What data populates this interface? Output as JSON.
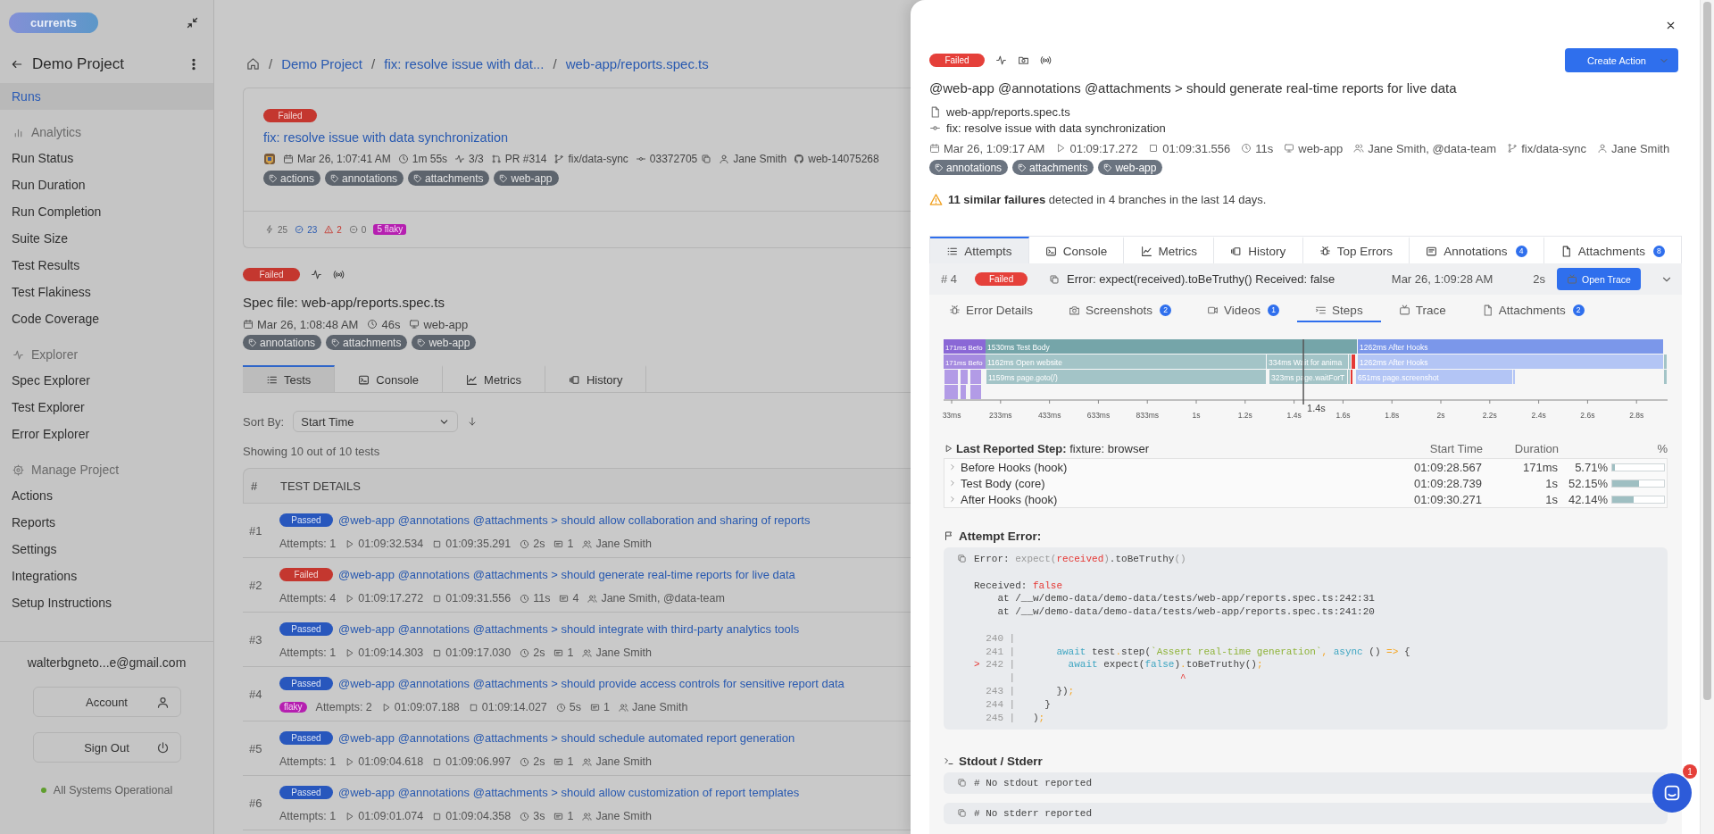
{
  "sidebar": {
    "logo": "currents",
    "project": "Demo Project",
    "nav": [
      {
        "label": "Runs",
        "selected": true
      }
    ],
    "sections": [
      {
        "kind": "analytics",
        "label": "Analytics",
        "items": [
          {
            "label": "Run Status",
            "selected": false
          },
          {
            "label": "Run Duration",
            "selected": false
          },
          {
            "label": "Run Completion",
            "selected": false
          },
          {
            "label": "Suite Size",
            "selected": false
          },
          {
            "label": "Test Results",
            "selected": false
          },
          {
            "label": "Test Flakiness",
            "selected": false
          },
          {
            "label": "Code Coverage",
            "selected": false
          }
        ]
      },
      {
        "kind": "explorer",
        "label": "Explorer",
        "items": [
          {
            "label": "Spec Explorer",
            "selected": false
          },
          {
            "label": "Test Explorer",
            "selected": false
          },
          {
            "label": "Error Explorer",
            "selected": false
          }
        ]
      },
      {
        "kind": "manage",
        "label": "Manage Project",
        "items": [
          {
            "label": "Actions",
            "selected": false
          },
          {
            "label": "Reports",
            "selected": false
          },
          {
            "label": "Settings",
            "selected": false
          },
          {
            "label": "Integrations",
            "selected": false
          },
          {
            "label": "Setup Instructions",
            "selected": false
          }
        ]
      }
    ],
    "email": "walterbgneto...e@gmail.com",
    "buttons": [
      {
        "kind": "account",
        "label": "Account"
      },
      {
        "kind": "sign-out",
        "label": "Sign Out"
      }
    ],
    "status": "All Systems Operational"
  },
  "main": {
    "breadcrumb": [
      {
        "kind": "home"
      },
      {
        "kind": "separator",
        "text": "/"
      },
      {
        "kind": "link",
        "text": "Demo Project"
      },
      {
        "kind": "separator",
        "text": "/"
      },
      {
        "kind": "link",
        "text": "fix: resolve issue with dat..."
      },
      {
        "kind": "separator",
        "text": "/"
      },
      {
        "kind": "link",
        "text": "web-app/reports.spec.ts"
      }
    ],
    "run": {
      "badge": {
        "label": "Failed",
        "kind": "failed"
      },
      "title": "fix: resolve issue with data synchronization",
      "meta": [
        {
          "kind": "date",
          "text": "Mar 26, 1:07:41 AM"
        },
        {
          "kind": "duration",
          "text": "1m 55s"
        },
        {
          "kind": "progress",
          "text": "3/3"
        },
        {
          "kind": "pull-request",
          "text": "PR #314"
        },
        {
          "kind": "branch",
          "text": "fix/data-sync"
        },
        {
          "kind": "commit",
          "text": "03372705"
        },
        {
          "kind": "user",
          "text": "Jane Smith"
        },
        {
          "kind": "github",
          "text": "web-14075268"
        }
      ],
      "tags": [
        "actions",
        "annotations",
        "attachments",
        "web-app"
      ],
      "stats": [
        {
          "kind": "total",
          "text": "25"
        },
        {
          "kind": "passed",
          "text": "23"
        },
        {
          "kind": "failed",
          "text": "2"
        },
        {
          "kind": "skipped",
          "text": "0"
        },
        {
          "kind": "flaky",
          "text": "5 flaky"
        }
      ]
    },
    "spec": {
      "badge": {
        "label": "Failed",
        "kind": "failed"
      },
      "title": "Spec file: web-app/reports.spec.ts",
      "meta": [
        {
          "kind": "date",
          "text": "Mar 26, 1:08:48 AM"
        },
        {
          "kind": "duration",
          "text": "46s"
        },
        {
          "kind": "machine",
          "text": "web-app"
        }
      ],
      "tags": [
        "annotations",
        "attachments",
        "web-app"
      ]
    },
    "tabs": [
      {
        "kind": "tests",
        "label": "Tests",
        "selected": true
      },
      {
        "kind": "console",
        "label": "Console",
        "selected": false
      },
      {
        "kind": "metrics",
        "label": "Metrics",
        "selected": false
      },
      {
        "kind": "history",
        "label": "History",
        "selected": false
      }
    ],
    "sort": {
      "label": "Sort By:",
      "value": "Start Time"
    },
    "count": "Showing 10 out of 10 tests",
    "table": {
      "columns": [
        "#",
        "TEST DETAILS"
      ],
      "rows": [
        {
          "index": "#1",
          "badge": {
            "label": "Passed",
            "kind": "passed"
          },
          "title": "@web-app @annotations @attachments > should allow collaboration and sharing of reports",
          "meta": [
            {
              "kind": "attempts",
              "text": "Attempts: 1"
            },
            {
              "kind": "start",
              "text": "01:09:32.534"
            },
            {
              "kind": "end",
              "text": "01:09:35.291"
            },
            {
              "kind": "duration",
              "text": "2s"
            },
            {
              "kind": "comments",
              "text": "1"
            },
            {
              "kind": "owners",
              "text": "Jane Smith"
            }
          ]
        },
        {
          "index": "#2",
          "badge": {
            "label": "Failed",
            "kind": "failed"
          },
          "title": "@web-app @annotations @attachments > should generate real-time reports for live data",
          "meta": [
            {
              "kind": "attempts",
              "text": "Attempts: 4"
            },
            {
              "kind": "start",
              "text": "01:09:17.272"
            },
            {
              "kind": "end",
              "text": "01:09:31.556"
            },
            {
              "kind": "duration",
              "text": "11s"
            },
            {
              "kind": "comments",
              "text": "4"
            },
            {
              "kind": "owners",
              "text": "Jane Smith, @data-team"
            }
          ]
        },
        {
          "index": "#3",
          "badge": {
            "label": "Passed",
            "kind": "passed"
          },
          "title": "@web-app @annotations @attachments > should integrate with third-party analytics tools",
          "meta": [
            {
              "kind": "attempts",
              "text": "Attempts: 1"
            },
            {
              "kind": "start",
              "text": "01:09:14.303"
            },
            {
              "kind": "end",
              "text": "01:09:17.030"
            },
            {
              "kind": "duration",
              "text": "2s"
            },
            {
              "kind": "comments",
              "text": "1"
            },
            {
              "kind": "owners",
              "text": "Jane Smith"
            }
          ]
        },
        {
          "index": "#4",
          "badge": {
            "label": "Passed",
            "kind": "passed"
          },
          "title": "@web-app @annotations @attachments > should provide access controls for sensitive report data",
          "flag": "flaky",
          "meta": [
            {
              "kind": "attempts",
              "text": "Attempts: 2"
            },
            {
              "kind": "start",
              "text": "01:09:07.188"
            },
            {
              "kind": "end",
              "text": "01:09:14.027"
            },
            {
              "kind": "duration",
              "text": "5s"
            },
            {
              "kind": "comments",
              "text": "1"
            },
            {
              "kind": "owners",
              "text": "Jane Smith"
            }
          ]
        },
        {
          "index": "#5",
          "badge": {
            "label": "Passed",
            "kind": "passed"
          },
          "title": "@web-app @annotations @attachments > should schedule automated report generation",
          "meta": [
            {
              "kind": "attempts",
              "text": "Attempts: 1"
            },
            {
              "kind": "start",
              "text": "01:09:04.618"
            },
            {
              "kind": "end",
              "text": "01:09:06.997"
            },
            {
              "kind": "duration",
              "text": "2s"
            },
            {
              "kind": "comments",
              "text": "1"
            },
            {
              "kind": "owners",
              "text": "Jane Smith"
            }
          ]
        },
        {
          "index": "#6",
          "badge": {
            "label": "Passed",
            "kind": "passed"
          },
          "title": "@web-app @annotations @attachments > should allow customization of report templates",
          "meta": [
            {
              "kind": "attempts",
              "text": "Attempts: 1"
            },
            {
              "kind": "start",
              "text": "01:09:01.074"
            },
            {
              "kind": "end",
              "text": "01:09:04.358"
            },
            {
              "kind": "duration",
              "text": "3s"
            },
            {
              "kind": "comments",
              "text": "1"
            },
            {
              "kind": "owners",
              "text": "Jane Smith"
            }
          ]
        }
      ]
    }
  },
  "drawer": {
    "badge": {
      "label": "Failed",
      "kind": "failed"
    },
    "action": "Create Action",
    "title": "@web-app @annotations @attachments > should generate real-time reports for live data",
    "file": "web-app/reports.spec.ts",
    "commit": "fix: resolve issue with data synchronization",
    "meta": [
      {
        "kind": "date",
        "text": "Mar 26, 1:09:17 AM"
      },
      {
        "kind": "start",
        "text": "01:09:17.272"
      },
      {
        "kind": "end",
        "text": "01:09:31.556"
      },
      {
        "kind": "duration",
        "text": "11s"
      },
      {
        "kind": "machine",
        "text": "web-app"
      },
      {
        "kind": "owners",
        "text": "Jane Smith, @data-team"
      },
      {
        "kind": "branch",
        "text": "fix/data-sync"
      },
      {
        "kind": "user",
        "text": "Jane Smith"
      }
    ],
    "tags": [
      "annotations",
      "attachments",
      "web-app"
    ],
    "warning": "**11 similar failures** detected in 4 branches in the last 14 days.",
    "tabs": [
      {
        "kind": "attempts",
        "label": "Attempts",
        "selected": true
      },
      {
        "kind": "console",
        "label": "Console",
        "selected": false
      },
      {
        "kind": "metrics",
        "label": "Metrics",
        "selected": false
      },
      {
        "kind": "history",
        "label": "History",
        "selected": false
      },
      {
        "kind": "errors",
        "label": "Top Errors",
        "selected": false
      },
      {
        "kind": "annotations",
        "label": "Annotations",
        "count": "4",
        "selected": false
      },
      {
        "kind": "attachments",
        "label": "Attachments",
        "count": "8",
        "selected": false
      }
    ],
    "attempt": {
      "number": "# 4",
      "badge": {
        "label": "Failed",
        "kind": "failed"
      },
      "error": "Error: expect(received).toBeTruthy() Received: false",
      "time": "Mar 26, 1:09:28 AM",
      "duration": "2s",
      "button": "Open Trace",
      "expanded": true
    },
    "subtabs": [
      {
        "kind": "errors",
        "label": "Error Details",
        "selected": false
      },
      {
        "kind": "screenshots",
        "label": "Screenshots",
        "count": "2",
        "selected": false
      },
      {
        "kind": "videos",
        "label": "Videos",
        "count": "1",
        "selected": false
      },
      {
        "kind": "steps",
        "label": "Steps",
        "selected": true
      },
      {
        "kind": "trace",
        "label": "Trace",
        "selected": false
      },
      {
        "kind": "attachments",
        "label": "Attachments",
        "count": "2",
        "selected": false
      }
    ],
    "timeline": {
      "ticks": [
        "33ms",
        "233ms",
        "433ms",
        "633ms",
        "833ms",
        "1s",
        "1.2s",
        "1.4s",
        "1.6s",
        "1.8s",
        "2s",
        "2.2s",
        "2.4s",
        "2.6s",
        "2.8s"
      ],
      "cursor": "1.4s",
      "lanes": [
        {
          "bars": [
            {
              "label": "171ms Befo",
              "color": "#8a67d6"
            },
            {
              "label": "1530ms Test Body",
              "color": "#75a5a9"
            },
            {
              "label": "1262ms After Hooks",
              "color": "#7b97ea"
            }
          ]
        },
        {
          "bars": [
            {
              "label": "171ms Befo",
              "color": "#a58ae0"
            },
            {
              "label": "1162ms Open website",
              "color": "#a3c4c7"
            },
            {
              "label": "334ms Wait for anima",
              "color": "#a3c4c7"
            },
            {
              "color": "#a3c4c7"
            },
            {
              "color": "#e53935"
            },
            {
              "label": "1262ms After Hooks",
              "color": "#b3c5f5"
            },
            {
              "color": "#a3c4c7"
            }
          ]
        },
        {
          "bars": [
            {
              "color": "#b29be6"
            },
            {
              "color": "#b29be6"
            },
            {
              "color": "#b29be6"
            },
            {
              "label": "1159ms page.goto(/)",
              "color": "#a3c4c7"
            },
            {
              "label": "323ms page.waitForT",
              "color": "#a3c4c7"
            },
            {
              "color": "#a3c4c7"
            },
            {
              "color": "#e53935"
            },
            {
              "label": "651ms page.screenshot",
              "color": "#b3c5f5"
            },
            {
              "color": "#b3c5f5"
            },
            {
              "color": "#a3c4c7"
            }
          ]
        },
        {
          "bars": [
            {
              "color": "#b29be6"
            },
            {
              "color": "#b29be6"
            },
            {
              "color": "#b29be6"
            }
          ]
        }
      ]
    },
    "last_step": "**Last Reported Step:** fixture: browser",
    "steps": {
      "columns": [
        "Start Time",
        "Duration",
        "%"
      ],
      "rows": [
        {
          "name": "Before Hooks (hook)",
          "start": "01:09:28.567",
          "duration": "171ms",
          "percent": "5.71%",
          "level": 0.0571
        },
        {
          "name": "Test Body (core)",
          "start": "01:09:28.739",
          "duration": "1s",
          "percent": "52.15%",
          "level": 0.5215
        },
        {
          "name": "After Hooks (hook)",
          "start": "01:09:30.271",
          "duration": "1s",
          "percent": "42.14%",
          "level": 0.4214
        }
      ]
    },
    "attempt_error": {
      "title": "Attempt Error:",
      "lines": [
        {
          "kind": "text",
          "tokens": [
            {
              "text": "Error: ",
              "kind": "plain"
            },
            {
              "text": "expect(",
              "kind": "dim"
            },
            {
              "text": "received",
              "kind": "red"
            },
            {
              "text": ")",
              "kind": "dim"
            },
            {
              "text": ".toBeTruthy",
              "kind": "plain"
            },
            {
              "text": "()",
              "kind": "dim"
            }
          ]
        },
        {
          "kind": "gap"
        },
        {
          "kind": "text",
          "tokens": [
            {
              "text": "Received: ",
              "kind": "plain"
            },
            {
              "text": "false",
              "kind": "red"
            }
          ]
        },
        {
          "kind": "text",
          "tokens": [
            {
              "text": "    at /__w/demo-data/demo-data/tests/web-app/reports.spec.ts:242:31",
              "kind": "plain"
            }
          ]
        },
        {
          "kind": "text",
          "tokens": [
            {
              "text": "    at /__w/demo-data/demo-data/tests/web-app/reports.spec.ts:241:20",
              "kind": "plain"
            }
          ]
        },
        {
          "kind": "gap"
        },
        {
          "kind": "code",
          "gutter": "240 |"
        },
        {
          "kind": "code",
          "gutter": "241 |",
          "tokens": [
            {
              "text": "      await",
              "kind": "keyword"
            },
            {
              "text": " test",
              "kind": "plain"
            },
            {
              "text": ".",
              "kind": "punct"
            },
            {
              "text": "step(",
              "kind": "plain"
            },
            {
              "text": "`Assert real-time generation`",
              "kind": "string"
            },
            {
              "text": ", ",
              "kind": "punct"
            },
            {
              "text": "async",
              "kind": "keyword"
            },
            {
              "text": " () ",
              "kind": "plain"
            },
            {
              "text": "=>",
              "kind": "punct"
            },
            {
              "text": " {",
              "kind": "plain"
            }
          ]
        },
        {
          "kind": "code",
          "marker": ">",
          "gutter": "242 |",
          "tokens": [
            {
              "text": "        await",
              "kind": "keyword"
            },
            {
              "text": " expect(",
              "kind": "plain"
            },
            {
              "text": "false",
              "kind": "keyword"
            },
            {
              "text": ")",
              "kind": "plain"
            },
            {
              "text": ".",
              "kind": "punct"
            },
            {
              "text": "toBeTruthy()",
              "kind": "plain"
            },
            {
              "text": ";",
              "kind": "punct"
            }
          ]
        },
        {
          "kind": "code",
          "gutter": "|",
          "tokens": [
            {
              "text": "                           ^",
              "kind": "red"
            }
          ]
        },
        {
          "kind": "code",
          "gutter": "243 |",
          "tokens": [
            {
              "text": "      })",
              "kind": "plain"
            },
            {
              "text": ";",
              "kind": "punct"
            }
          ]
        },
        {
          "kind": "code",
          "gutter": "244 |",
          "tokens": [
            {
              "text": "    }",
              "kind": "plain"
            }
          ]
        },
        {
          "kind": "code",
          "gutter": "245 |",
          "tokens": [
            {
              "text": "  )",
              "kind": "plain"
            },
            {
              "text": ";",
              "kind": "punct"
            }
          ]
        }
      ]
    },
    "output": {
      "title": "Stdout / Stderr",
      "blocks": [
        "# No stdout reported",
        "# No stderr reported"
      ]
    }
  },
  "chat": {
    "badge": "1"
  }
}
